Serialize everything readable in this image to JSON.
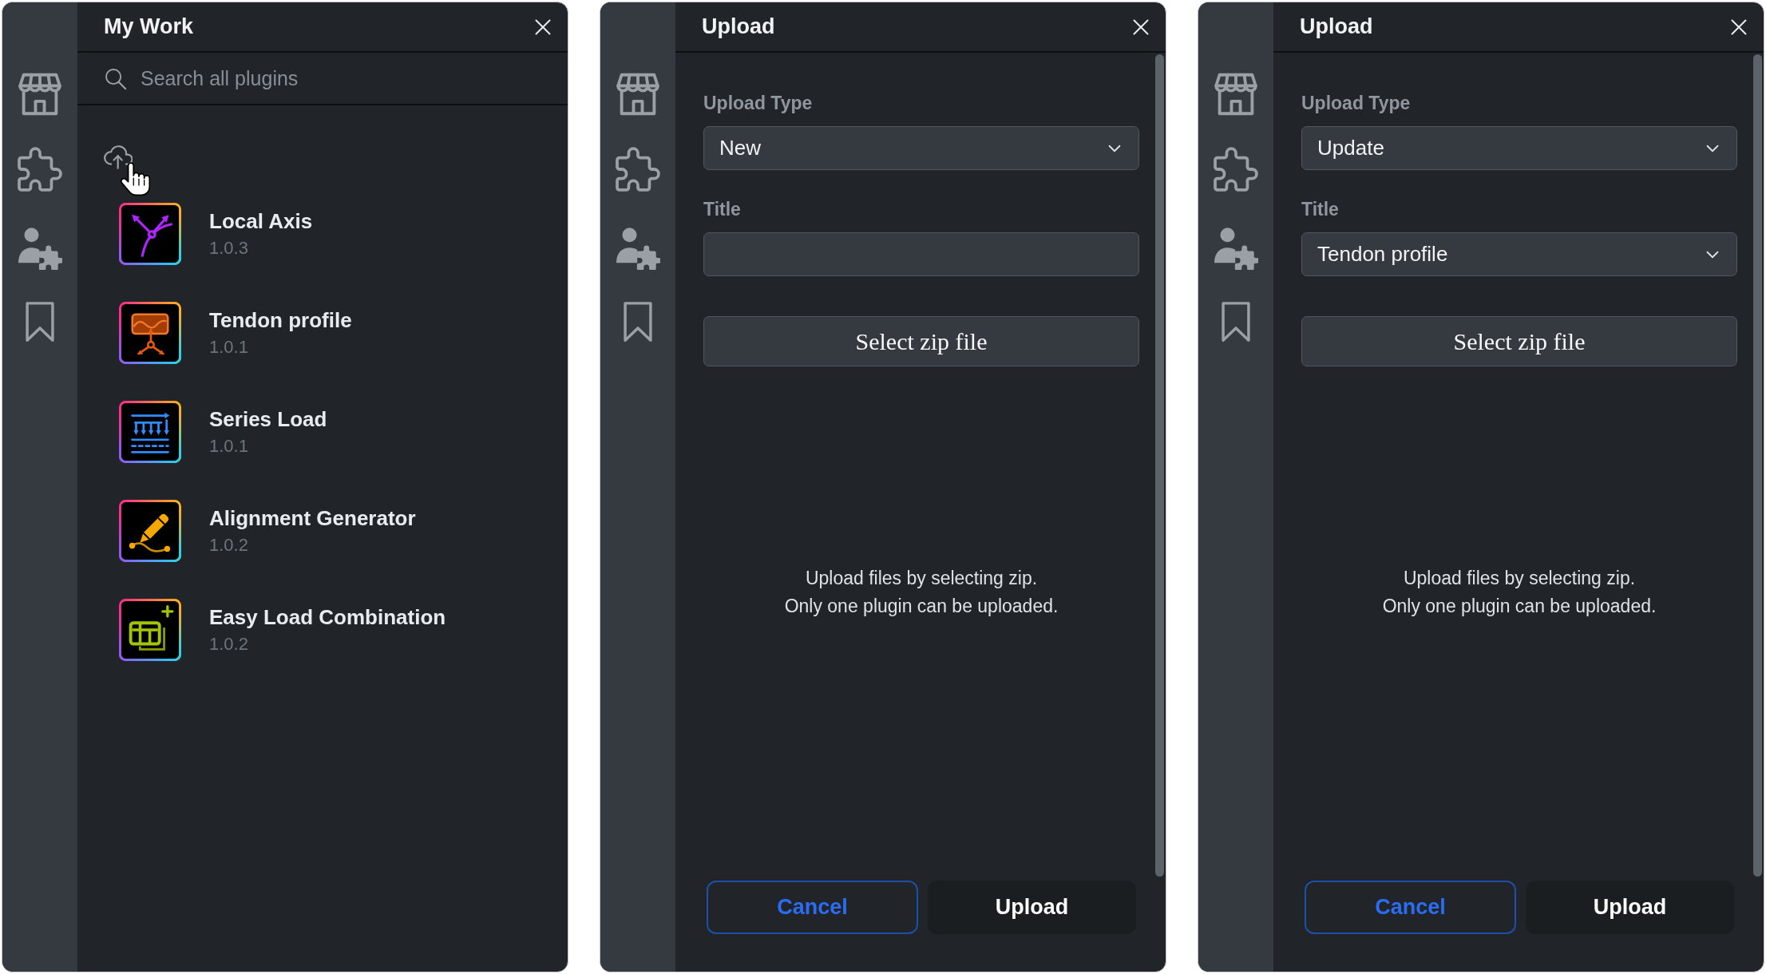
{
  "panels": [
    {
      "kind": "plugins",
      "title": "My Work",
      "search": {
        "placeholder": "Search all plugins"
      },
      "plugins": [
        {
          "name": "Local Axis",
          "version": "1.0.3"
        },
        {
          "name": "Tendon profile",
          "version": "1.0.1"
        },
        {
          "name": "Series Load",
          "version": "1.0.1"
        },
        {
          "name": "Alignment Generator",
          "version": "1.0.2"
        },
        {
          "name": "Easy Load Combination",
          "version": "1.0.2"
        }
      ]
    },
    {
      "kind": "upload",
      "title": "Upload",
      "fields": [
        {
          "kind": "select",
          "label": "Upload Type",
          "value": "New"
        },
        {
          "kind": "input",
          "label": "Title"
        }
      ],
      "file_button": "Select zip file",
      "help_text": [
        "Upload files by selecting zip.",
        "Only one plugin can be uploaded."
      ],
      "buttons": [
        {
          "kind": "cancel",
          "label": "Cancel"
        },
        {
          "kind": "submit",
          "label": "Upload"
        }
      ]
    },
    {
      "kind": "upload",
      "title": "Upload",
      "fields": [
        {
          "kind": "select",
          "label": "Upload Type",
          "value": "Update"
        },
        {
          "kind": "select",
          "label": "Title",
          "value": "Tendon profile"
        }
      ],
      "file_button": "Select zip file",
      "help_text": [
        "Upload files by selecting zip.",
        "Only one plugin can be uploaded."
      ],
      "buttons": [
        {
          "kind": "cancel",
          "label": "Cancel"
        },
        {
          "kind": "submit",
          "label": "Upload"
        }
      ]
    }
  ]
}
